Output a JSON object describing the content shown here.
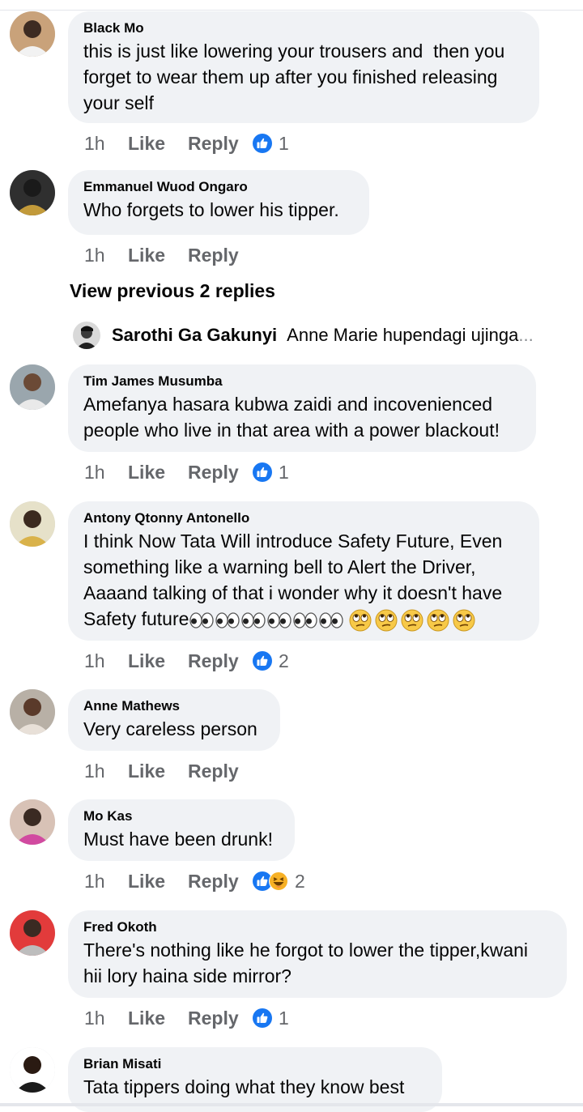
{
  "colors": {
    "bubble": "#f0f2f5",
    "meta": "#65676b",
    "like_blue": "#1877f2",
    "haha_yellow": "#f7b125"
  },
  "view_previous_label": "View previous 2 replies",
  "nested_reply": {
    "author": "Sarothi Ga Gakunyi",
    "text": "Anne Marie hupendagi ujinga",
    "ellipsis": "..."
  },
  "comments": [
    {
      "author": "Black Mo",
      "lines": [
        "this is just like lowering your trousers and  then you",
        "forget to wear them up after you finished releasing",
        "your self"
      ],
      "time": "1h",
      "like": "Like",
      "reply": "Reply",
      "reactions": [
        "like"
      ],
      "reaction_count": "1"
    },
    {
      "author": "Emmanuel Wuod Ongaro",
      "lines": [
        "Who forgets to lower his tipper."
      ],
      "time": "1h",
      "like": "Like",
      "reply": "Reply",
      "reactions": [],
      "reaction_count": ""
    },
    {
      "author": "Tim James Musumba",
      "lines": [
        "Amefanya hasara kubwa zaidi and incovenienced",
        "people who live in that area with a power blackout!"
      ],
      "time": "1h",
      "like": "Like",
      "reply": "Reply",
      "reactions": [
        "like"
      ],
      "reaction_count": "1"
    },
    {
      "author": "Antony Qtonny Antonello",
      "lines": [
        "I think Now Tata Will introduce Safety Future, Even",
        "something like a warning bell to Alert the Driver,",
        "Aaaand talking of that i wonder why it doesn't have",
        "Safety future"
      ],
      "emoji_eyes": 6,
      "emoji_rolling": 5,
      "time": "1h",
      "like": "Like",
      "reply": "Reply",
      "reactions": [
        "like"
      ],
      "reaction_count": "2"
    },
    {
      "author": "Anne Mathews",
      "lines": [
        "Very careless person"
      ],
      "time": "1h",
      "like": "Like",
      "reply": "Reply",
      "reactions": [],
      "reaction_count": ""
    },
    {
      "author": "Mo Kas",
      "lines": [
        "Must have been drunk!"
      ],
      "time": "1h",
      "like": "Like",
      "reply": "Reply",
      "reactions": [
        "like",
        "haha"
      ],
      "reaction_count": "2"
    },
    {
      "author": "Fred Okoth",
      "lines": [
        "There's nothing like he forgot to lower the tipper,kwani",
        "hii lory haina side mirror?"
      ],
      "time": "1h",
      "like": "Like",
      "reply": "Reply",
      "reactions": [
        "like"
      ],
      "reaction_count": "1"
    },
    {
      "author": "Brian Misati",
      "lines": [
        "Tata tippers doing what they know best"
      ],
      "time": "",
      "like": "",
      "reply": "",
      "reactions": [],
      "reaction_count": ""
    }
  ]
}
